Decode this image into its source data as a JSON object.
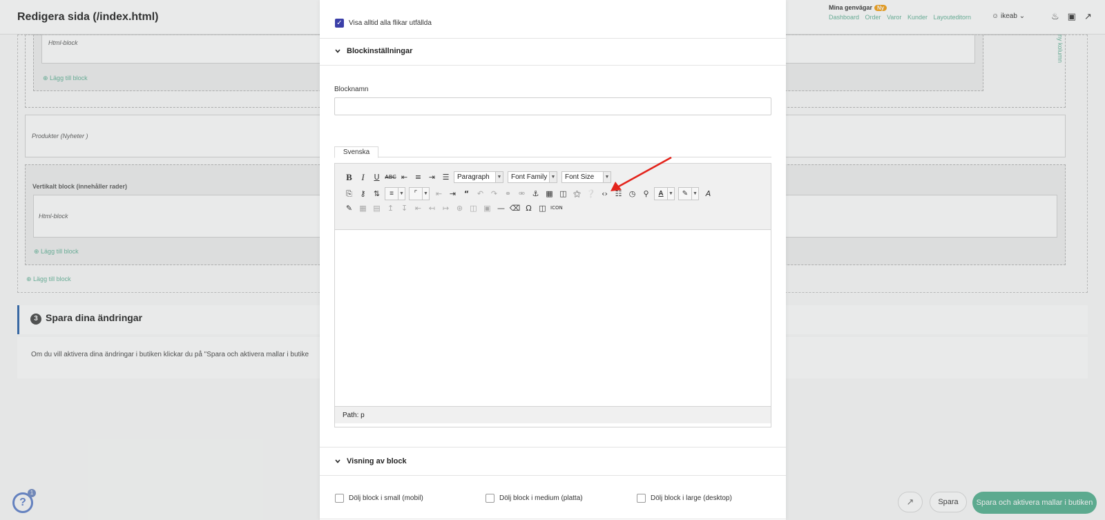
{
  "background": {
    "page_title": "Redigera sida (/index.html)",
    "shortcuts_label": "Mina genvägar",
    "shortcuts_badge": "Ny",
    "shortcut_links": [
      "Dashboard",
      "Order",
      "Varor",
      "Kunder",
      "Layouteditorn"
    ],
    "user_name": "ikeab",
    "html_block_1": "Html-block",
    "add_block_1": "Lägg till block",
    "products_block": "Produkter (Nyheter )",
    "vertical_block": "Vertikalt block (innehåller rader)",
    "html_block_2": "Html-block",
    "add_block_2": "Lägg till block",
    "add_block_3": "Lägg till block",
    "side_vertical": "ny kolumn",
    "step_number": "3",
    "step_title": "Spara dina ändringar",
    "step_text": "Om du vill aktivera dina ändringar i butiken klickar du på \"Spara och aktivera mallar i butike",
    "help_badge": "1",
    "save_label": "Spara",
    "save_activate_label": "Spara och aktivera mallar i butiken"
  },
  "modal": {
    "show_tabs_label": "Visa alltid alla flikar utfällda",
    "show_tabs_checked": true,
    "block_settings_title": "Blockinställningar",
    "block_name_label": "Blocknamn",
    "block_name_value": "",
    "language_tab": "Svenska",
    "editor": {
      "format_select": "Paragraph",
      "font_family_select": "Font Family",
      "font_size_select": "Font Size",
      "path_text": "Path: p",
      "toolbar_icons": [
        "bold-icon",
        "italic-icon",
        "underline-icon",
        "strikethrough-icon",
        "align-left-icon",
        "align-center-icon",
        "align-right-icon",
        "align-justify-icon",
        "paste-word-icon",
        "find-icon",
        "replace-icon",
        "bullet-list-icon",
        "numbered-list-icon",
        "outdent-icon",
        "indent-icon",
        "blockquote-icon",
        "undo-icon",
        "redo-icon",
        "link-icon",
        "unlink-icon",
        "anchor-icon",
        "image-icon",
        "file-browser-icon",
        "cleanup-icon",
        "help-icon",
        "html-source-icon",
        "insert-date-icon",
        "insert-time-icon",
        "preview-icon",
        "text-color-icon",
        "background-color-icon",
        "styles-icon",
        "visual-aid-icon",
        "table-icon",
        "row-props-icon",
        "insert-row-before-icon",
        "insert-row-after-icon",
        "delete-row-icon",
        "insert-col-before-icon",
        "insert-col-after-icon",
        "delete-col-icon",
        "split-cells-icon",
        "merge-cells-icon",
        "horizontal-rule-icon",
        "remove-format-icon",
        "special-char-icon",
        "media-icon",
        "icon-insert-icon"
      ]
    },
    "block_display_title": "Visning av block",
    "hide_small_label": "Dölj block i small (mobil)",
    "hide_medium_label": "Dölj block i medium (platta)",
    "hide_large_label": "Dölj block i large (desktop)",
    "hide_small_checked": false,
    "hide_medium_checked": false,
    "hide_large_checked": false
  },
  "annotation": {
    "arrow_color": "#e3231b",
    "points_to": "html-source-icon"
  }
}
